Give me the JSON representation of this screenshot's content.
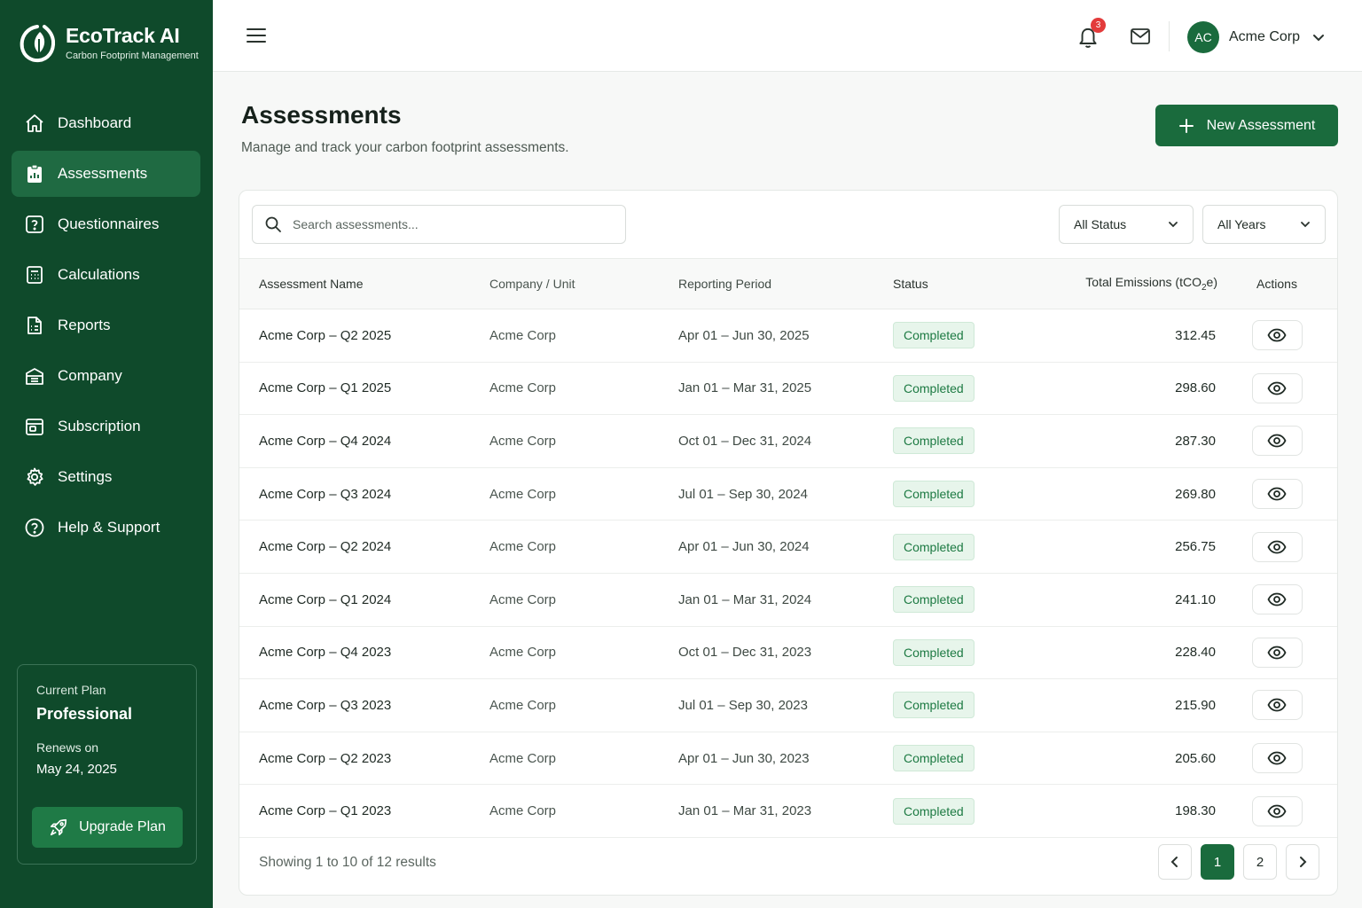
{
  "brand": {
    "name": "EcoTrack AI",
    "tagline": "Carbon Footprint Management"
  },
  "sidebar": {
    "items": [
      {
        "label": "Dashboard",
        "icon": "home-icon",
        "active": false
      },
      {
        "label": "Assessments",
        "icon": "clipboard-icon",
        "active": true
      },
      {
        "label": "Questionnaires",
        "icon": "question-icon",
        "active": false
      },
      {
        "label": "Calculations",
        "icon": "calculator-icon",
        "active": false
      },
      {
        "label": "Reports",
        "icon": "report-icon",
        "active": false
      },
      {
        "label": "Company",
        "icon": "building-icon",
        "active": false
      },
      {
        "label": "Subscription",
        "icon": "card-icon",
        "active": false
      },
      {
        "label": "Settings",
        "icon": "gear-icon",
        "active": false
      },
      {
        "label": "Help & Support",
        "icon": "help-icon",
        "active": false
      }
    ],
    "plan": {
      "label": "Current Plan",
      "name": "Professional",
      "renew_label": "Renews on",
      "renew_date": "May 24, 2025",
      "upgrade_label": "Upgrade Plan"
    }
  },
  "topbar": {
    "notification_count": "3",
    "user": {
      "initials": "AC",
      "name": "Acme Corp"
    }
  },
  "header": {
    "title": "Assessments",
    "subtitle": "Manage and track your carbon footprint assessments.",
    "new_button": "New Assessment"
  },
  "filters": {
    "search_placeholder": "Search assessments...",
    "status": "All Status",
    "years": "All Years"
  },
  "table": {
    "columns": {
      "name": "Assessment Name",
      "company": "Company / Unit",
      "period": "Reporting Period",
      "status": "Status",
      "emissions_prefix": "Total Emissions (tCO",
      "emissions_sub": "2",
      "emissions_suffix": "e)",
      "actions": "Actions"
    },
    "rows": [
      {
        "name": "Acme Corp – Q2 2025",
        "company": "Acme Corp",
        "period": "Apr 01 – Jun 30, 2025",
        "status": "Completed",
        "emissions": "312.45"
      },
      {
        "name": "Acme Corp – Q1 2025",
        "company": "Acme Corp",
        "period": "Jan 01 – Mar 31, 2025",
        "status": "Completed",
        "emissions": "298.60"
      },
      {
        "name": "Acme Corp – Q4 2024",
        "company": "Acme Corp",
        "period": "Oct 01 – Dec 31, 2024",
        "status": "Completed",
        "emissions": "287.30"
      },
      {
        "name": "Acme Corp – Q3 2024",
        "company": "Acme Corp",
        "period": "Jul 01 – Sep 30, 2024",
        "status": "Completed",
        "emissions": "269.80"
      },
      {
        "name": "Acme Corp – Q2 2024",
        "company": "Acme Corp",
        "period": "Apr 01 – Jun 30, 2024",
        "status": "Completed",
        "emissions": "256.75"
      },
      {
        "name": "Acme Corp – Q1 2024",
        "company": "Acme Corp",
        "period": "Jan 01 – Mar 31, 2024",
        "status": "Completed",
        "emissions": "241.10"
      },
      {
        "name": "Acme Corp – Q4 2023",
        "company": "Acme Corp",
        "period": "Oct 01 – Dec 31, 2023",
        "status": "Completed",
        "emissions": "228.40"
      },
      {
        "name": "Acme Corp – Q3 2023",
        "company": "Acme Corp",
        "period": "Jul 01 – Sep 30, 2023",
        "status": "Completed",
        "emissions": "215.90"
      },
      {
        "name": "Acme Corp – Q2 2023",
        "company": "Acme Corp",
        "period": "Apr 01 – Jun 30, 2023",
        "status": "Completed",
        "emissions": "205.60"
      },
      {
        "name": "Acme Corp – Q1 2023",
        "company": "Acme Corp",
        "period": "Jan 01 – Mar 31, 2023",
        "status": "Completed",
        "emissions": "198.30"
      }
    ]
  },
  "pagination": {
    "summary": "Showing 1 to 10 of 12 results",
    "pages": [
      "1",
      "2"
    ],
    "current": "1"
  },
  "colors": {
    "sidebar": "#0f4a2b",
    "accent": "#1a6b3d",
    "badge_bg": "#e7f5eb",
    "badge_text": "#1d7a43",
    "notification": "#e33b3b"
  }
}
